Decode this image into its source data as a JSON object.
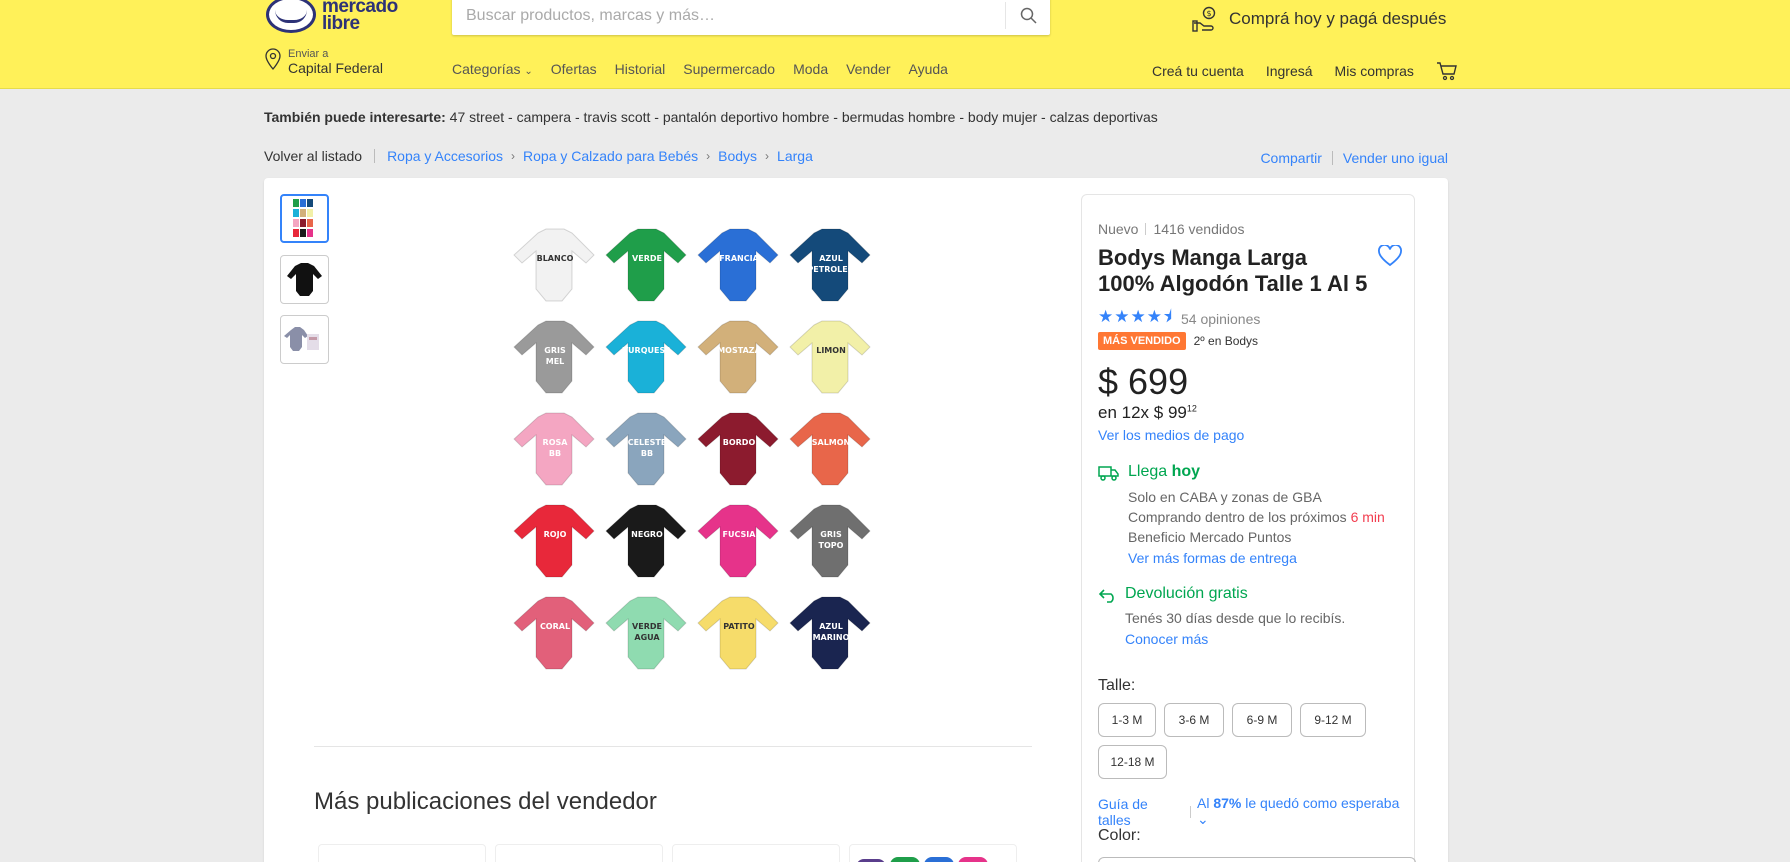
{
  "header": {
    "logo_line1": "mercado",
    "logo_line2": "libre",
    "search_placeholder": "Buscar productos, marcas y más…",
    "promo": "Comprá hoy y pagá después",
    "location_small": "Enviar a",
    "location_big": "Capital Federal",
    "nav": [
      "Categorías",
      "Ofertas",
      "Historial",
      "Supermercado",
      "Moda",
      "Vender",
      "Ayuda"
    ],
    "user_nav": [
      "Creá tu cuenta",
      "Ingresá",
      "Mis compras"
    ],
    "brand_yellow": "#fff159",
    "brand_blue": "#2d3277"
  },
  "interest": {
    "label": "También puede interesarte:",
    "items": " 47 street - campera - travis scott - pantalón deportivo hombre - bermudas hombre - body mujer - calzas deportivas"
  },
  "breadcrumb": {
    "back": "Volver al listado",
    "items": [
      "Ropa y Accesorios",
      "Ropa y Calzado para Bebés",
      "Bodys",
      "Larga"
    ]
  },
  "share": {
    "share": "Compartir",
    "sell": "Vender uno igual"
  },
  "gallery": {
    "bodies": [
      {
        "label": "BLANCO",
        "color": "#f2f2f2",
        "text": "#333"
      },
      {
        "label": "VERDE",
        "color": "#1f9e4a",
        "text": "#fff"
      },
      {
        "label": "FRANCIA",
        "color": "#2a6fd6",
        "text": "#fff"
      },
      {
        "label": "AZUL PETROLEO",
        "color": "#144a7a",
        "text": "#fff"
      },
      {
        "label": "GRIS MEL",
        "color": "#9a9a9a",
        "text": "#fff"
      },
      {
        "label": "TURQUESA",
        "color": "#1ab1d8",
        "text": "#fff"
      },
      {
        "label": "MOSTAZA",
        "color": "#d2b07a",
        "text": "#fff"
      },
      {
        "label": "LIMON",
        "color": "#f2f0a8",
        "text": "#333"
      },
      {
        "label": "ROSA BB",
        "color": "#f4a6c2",
        "text": "#fff"
      },
      {
        "label": "CELESTE BB",
        "color": "#8aa5bd",
        "text": "#fff"
      },
      {
        "label": "BORDO",
        "color": "#8c1b2e",
        "text": "#fff"
      },
      {
        "label": "SALMON",
        "color": "#e8664a",
        "text": "#fff"
      },
      {
        "label": "ROJO",
        "color": "#e8283a",
        "text": "#fff"
      },
      {
        "label": "NEGRO",
        "color": "#1a1a1a",
        "text": "#fff"
      },
      {
        "label": "FUCSIA",
        "color": "#e6338a",
        "text": "#fff"
      },
      {
        "label": "GRIS TOPO",
        "color": "#6f6f6f",
        "text": "#fff"
      },
      {
        "label": "CORAL",
        "color": "#e2607a",
        "text": "#fff"
      },
      {
        "label": "VERDE AGUA",
        "color": "#8fdbb0",
        "text": "#333"
      },
      {
        "label": "PATITO",
        "color": "#f6dc6a",
        "text": "#333"
      },
      {
        "label": "AZUL MARINO",
        "color": "#1a2550",
        "text": "#fff"
      }
    ]
  },
  "more": {
    "title": "Más publicaciones del vendedor"
  },
  "product": {
    "condition": "Nuevo",
    "sold": "1416 vendidos",
    "title": "Bodys Manga Larga 100% Algodón Talle 1 Al 5",
    "rating": 4.5,
    "stars": "★★★★⯨",
    "reviews": "54 opiniones",
    "badge": "MÁS VENDIDO",
    "badge_color": "#ff7733",
    "rank": "2º en Bodys",
    "price": "$ 699",
    "installments_prefix": "en 12x $ 99",
    "installments_cents": "12",
    "pay_link": "Ver los medios de pago"
  },
  "shipping": {
    "title_prefix": "Llega ",
    "title_bold": "hoy",
    "line1": "Solo en CABA y zonas de GBA",
    "line2_prefix": "Comprando dentro de los próximos ",
    "line2_time": "6 min",
    "line3": "Beneficio Mercado Puntos",
    "link": "Ver más formas de entrega",
    "green": "#00a650"
  },
  "returns": {
    "title": "Devolución gratis",
    "line": "Tenés 30 días desde que lo recibís.",
    "link": "Conocer más"
  },
  "sizes": {
    "label": "Talle:",
    "options": [
      "1-3 M",
      "3-6 M",
      "6-9 M",
      "9-12 M",
      "12-18 M"
    ],
    "guide": "Guía de talles",
    "fit_prefix": "Al ",
    "fit_pct": "87%",
    "fit_suffix": " le quedó como esperaba"
  },
  "color": {
    "label": "Color:"
  }
}
